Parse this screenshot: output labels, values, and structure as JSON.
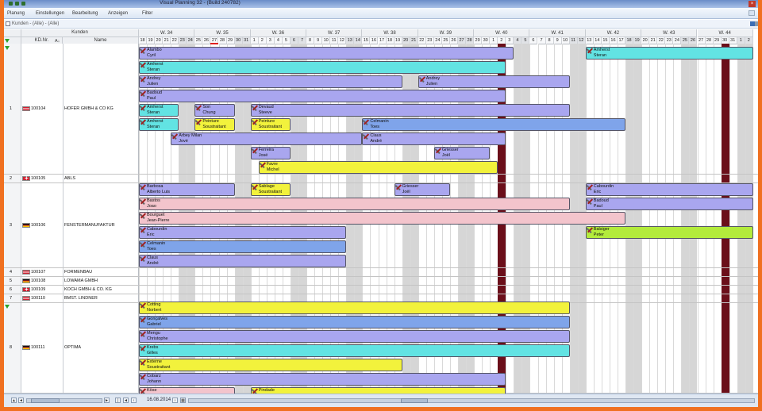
{
  "window": {
    "title": "Visual Planning 32 - (Build 240782)"
  },
  "menu": [
    {
      "label": "Planung"
    },
    {
      "label": "Einstellungen"
    },
    {
      "label": "Bearbeitung"
    },
    {
      "label": "Anzeigen"
    },
    {
      "label": "Filter"
    }
  ],
  "subbar": {
    "label": "Kunden - (Alle) - (Alle)"
  },
  "columns": {
    "group": "Kunden",
    "kd": "KD.Nr.",
    "name": "Name",
    "sort": "A↓"
  },
  "weeks": [
    {
      "label": "W. 34",
      "days": [
        "18",
        "19",
        "20",
        "21",
        "22",
        "23",
        "24"
      ]
    },
    {
      "label": "W. 35",
      "days": [
        "25",
        "26",
        "27",
        "28",
        "29",
        "30",
        "31"
      ]
    },
    {
      "label": "W. 36",
      "days": [
        "1",
        "2",
        "3",
        "4",
        "5",
        "6",
        "7"
      ]
    },
    {
      "label": "W. 37",
      "days": [
        "8",
        "9",
        "10",
        "11",
        "12",
        "13",
        "14"
      ]
    },
    {
      "label": "W. 38",
      "days": [
        "15",
        "16",
        "17",
        "18",
        "19",
        "20",
        "21"
      ]
    },
    {
      "label": "W. 39",
      "days": [
        "22",
        "23",
        "24",
        "25",
        "26",
        "27",
        "28"
      ]
    },
    {
      "label": "W. 40",
      "days": [
        "29",
        "30",
        "1",
        "2",
        "3",
        "4",
        "5"
      ]
    },
    {
      "label": "W. 41",
      "days": [
        "6",
        "7",
        "8",
        "9",
        "10",
        "11",
        "12"
      ]
    },
    {
      "label": "W. 42",
      "days": [
        "13",
        "14",
        "15",
        "16",
        "17",
        "18",
        "19"
      ]
    },
    {
      "label": "W. 43",
      "days": [
        "20",
        "21",
        "22",
        "23",
        "24",
        "25",
        "26"
      ]
    },
    {
      "label": "W. 44",
      "days": [
        "27",
        "28",
        "29",
        "30",
        "31",
        "1",
        "2"
      ]
    }
  ],
  "rows": [
    {
      "num": "1",
      "flag": "at",
      "kd": "100104",
      "name": "HOFER GMBH & CO KG"
    },
    {
      "num": "2",
      "flag": "ch",
      "kd": "100105",
      "name": "ABLS"
    },
    {
      "num": "3",
      "flag": "de",
      "kd": "100106",
      "name": "FENSTERMANUFAKTUR"
    },
    {
      "num": "4",
      "flag": "at",
      "kd": "100107",
      "name": "FORMENBAU"
    },
    {
      "num": "5",
      "flag": "de",
      "kd": "100108",
      "name": "LOWAMA GMBH"
    },
    {
      "num": "6",
      "flag": "ch",
      "kd": "100109",
      "name": "KOCH GMBH & CO. KG"
    },
    {
      "num": "7",
      "flag": "at",
      "kd": "100110",
      "name": "BMST. LINDNER"
    },
    {
      "num": "8",
      "flag": "de",
      "kd": "100111",
      "name": "OPTIMA"
    }
  ],
  "bars": [
    {
      "n1": "Alambo",
      "n2": "Cyril",
      "color": "#a9a6ef"
    },
    {
      "n1": "Amherst",
      "n2": "Steran",
      "color": "#62e3e3"
    },
    {
      "n1": "Amherst",
      "n2": "Steran",
      "color": "#62e3e3"
    },
    {
      "n1": "Andrey",
      "n2": "Julien",
      "color": "#a9a6ef"
    },
    {
      "n1": "Andrey",
      "n2": "Julien",
      "color": "#a9a6ef"
    },
    {
      "n1": "Badoud",
      "n2": "Paul",
      "color": "#a9a6ef"
    },
    {
      "n1": "Amherst",
      "n2": "Steran",
      "color": "#62e3e3"
    },
    {
      "n1": "Son",
      "n2": "Chung",
      "color": "#a9a6ef"
    },
    {
      "n1": "Devaud",
      "n2": "Steeve",
      "color": "#a9a6ef"
    },
    {
      "n1": "Amherst",
      "n2": "Steran",
      "color": "#62e3e3"
    },
    {
      "n1": "Peinture",
      "n2": "Soustraitant",
      "color": "#f2f23c"
    },
    {
      "n1": "Peinture",
      "n2": "Soustraitant",
      "color": "#f2f23c"
    },
    {
      "n1": "Celmanin",
      "n2": "Toes",
      "color": "#7fa4ea"
    },
    {
      "n1": "Arbey Milan",
      "n2": "Jové",
      "color": "#a9a6ef"
    },
    {
      "n1": "Claus",
      "n2": "André",
      "color": "#a9a6ef"
    },
    {
      "n1": "Ferreira",
      "n2": "José",
      "color": "#a9a6ef"
    },
    {
      "n1": "Griesser",
      "n2": "Joël",
      "color": "#a9a6ef"
    },
    {
      "n1": "Favre",
      "n2": "Michel",
      "color": "#f2f23c"
    },
    {
      "n1": "Barbosa",
      "n2": "Alberto Luis",
      "color": "#a9a6ef"
    },
    {
      "n1": "Sablage",
      "n2": "Soustraitant",
      "color": "#f2f23c"
    },
    {
      "n1": "Griesser",
      "n2": "Joël",
      "color": "#a9a6ef"
    },
    {
      "n1": "Cabourdin",
      "n2": "Eric",
      "color": "#a9a6ef"
    },
    {
      "n1": "Bastos",
      "n2": "Joao",
      "color": "#f3c4cc"
    },
    {
      "n1": "Badoud",
      "n2": "Paul",
      "color": "#a9a6ef"
    },
    {
      "n1": "Bourguet",
      "n2": "Jean-Pierre",
      "color": "#f3c4cc"
    },
    {
      "n1": "Cabourdin",
      "n2": "Eric",
      "color": "#a9a6ef"
    },
    {
      "n1": "Balsiger",
      "n2": "Peter",
      "color": "#b3eb3c"
    },
    {
      "n1": "Celmanin",
      "n2": "Toes",
      "color": "#7fa4ea"
    },
    {
      "n1": "Claus",
      "n2": "André",
      "color": "#a9a6ef"
    },
    {
      "n1": "Cotting",
      "n2": "Norbert",
      "color": "#f2f23c"
    },
    {
      "n1": "Gonçalves",
      "n2": "Gabriel",
      "color": "#7fa4ea"
    },
    {
      "n1": "Mengu",
      "n2": "Christophe",
      "color": "#a9a6ef"
    },
    {
      "n1": "Krebs",
      "n2": "Gilles",
      "color": "#62e3e3"
    },
    {
      "n1": "Externe",
      "n2": "Soustraitant",
      "color": "#f2f23c"
    },
    {
      "n1": "Cobarz",
      "n2": "Johann",
      "color": "#a9a6ef"
    },
    {
      "n1": "Köse",
      "n2": "",
      "color": "#f3c4cc"
    },
    {
      "n1": "Pindade",
      "n2": "",
      "color": "#f2f23c"
    }
  ],
  "status": {
    "date": "16.08.2014"
  }
}
